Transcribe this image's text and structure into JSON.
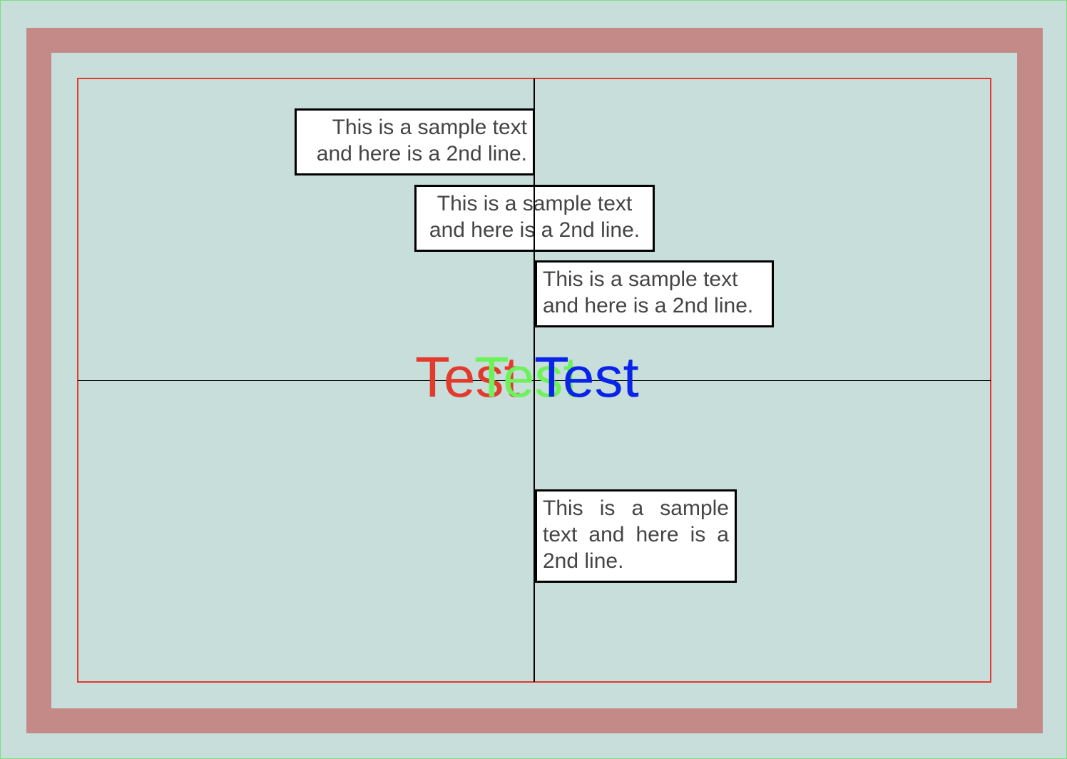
{
  "sample_text": {
    "line1": "This is a sample text",
    "line2": "and here is a 2nd line.",
    "full": "This is a sample text and here is a 2nd line."
  },
  "test_labels": {
    "red": "Test",
    "green": "Test",
    "blue": "Test"
  },
  "colors": {
    "background": "#c7dedb",
    "frame": "#c48a87",
    "content_border": "#e23a2c",
    "text_red": "#e23a2c",
    "text_green": "#6ef25a",
    "text_blue": "#0a23e8",
    "box_text": "#444444"
  }
}
